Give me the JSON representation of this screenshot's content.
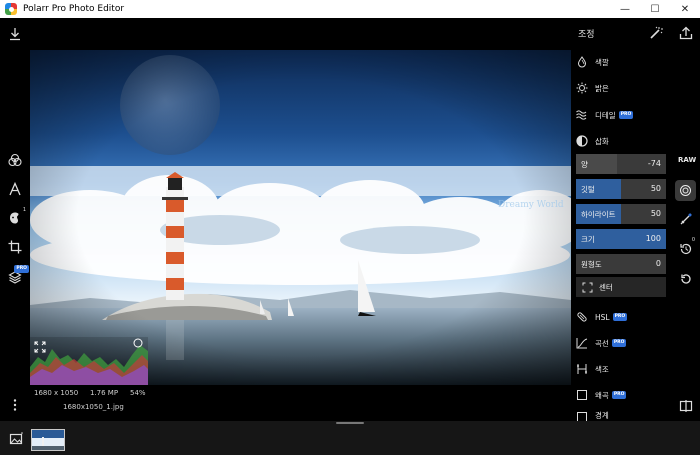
{
  "window": {
    "title": "Polarr Pro Photo Editor",
    "minimize": "—",
    "maximize": "☐",
    "close": "✕"
  },
  "left_toolbar": {
    "icons": [
      "download-icon",
      "filters-icon",
      "text-icon",
      "face-icon",
      "crop-icon",
      "layers-icon",
      "more-icon"
    ],
    "face_badge": "1"
  },
  "canvas": {
    "watermark": "Dreamy World",
    "info": {
      "dimensions": "1680 x 1050",
      "megapixels": "1.76 MP",
      "zoom": "54%"
    },
    "filename": "1680x1050_1.jpg"
  },
  "panel": {
    "title": "조정",
    "sections": {
      "color": "색깔",
      "light": "밝은",
      "detail": "디테일",
      "vignette": "삽화",
      "hsl": "HSL",
      "curves": "곡선",
      "toning": "색조",
      "distortion": "왜곡",
      "partial": "경계"
    },
    "pro_badge": "PRO",
    "sliders": [
      {
        "label": "양",
        "value": "-74",
        "amount": -74
      },
      {
        "label": "깃털",
        "value": "50",
        "amount": 50
      },
      {
        "label": "하이라이트",
        "value": "50",
        "amount": 50
      },
      {
        "label": "크기",
        "value": "100",
        "amount": 100
      },
      {
        "label": "원형도",
        "value": "0",
        "amount": 0
      }
    ],
    "center_label": "센터"
  },
  "right_column": {
    "raw_label": "RAW",
    "history_badge": "0"
  },
  "colors": {
    "slider_fill": "#2f5f9e",
    "slider_track": "#3a3a3a",
    "pro_badge": "#2f6fd8"
  }
}
